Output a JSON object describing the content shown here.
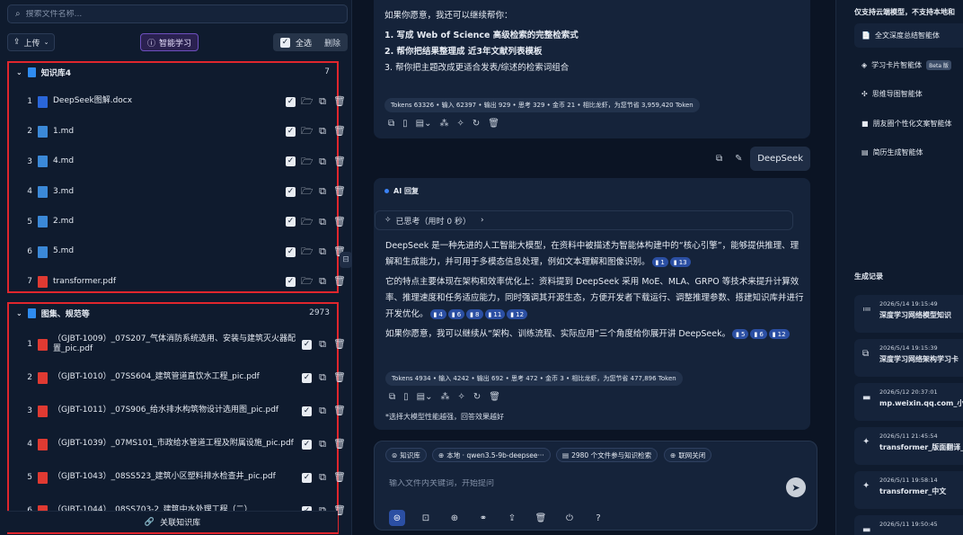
{
  "left": {
    "search_placeholder": "搜索文件名称...",
    "upload_label": "上传",
    "smart_label": "智能学习",
    "select_all_label": "全选",
    "delete_label": "删除",
    "kb1": {
      "name": "知识库4",
      "count": "7",
      "files": [
        {
          "num": "1",
          "name": "DeepSeek图解.docx",
          "type": "docx"
        },
        {
          "num": "2",
          "name": "1.md",
          "type": "md"
        },
        {
          "num": "3",
          "name": "4.md",
          "type": "md"
        },
        {
          "num": "4",
          "name": "3.md",
          "type": "md"
        },
        {
          "num": "5",
          "name": "2.md",
          "type": "md"
        },
        {
          "num": "6",
          "name": "5.md",
          "type": "md"
        },
        {
          "num": "7",
          "name": "transformer.pdf",
          "type": "pdf"
        }
      ]
    },
    "kb2": {
      "name": "图集、规范等",
      "count": "2973",
      "files": [
        {
          "num": "1",
          "name": "（GJBT-1009）_07S207_气体消防系统选用、安装与建筑灭火器配置_pic.pdf"
        },
        {
          "num": "2",
          "name": "（GJBT-1010）_07SS604_建筑管道直饮水工程_pic.pdf"
        },
        {
          "num": "3",
          "name": "（GJBT-1011）_07S906_给水排水构筑物设计选用图_pic.pdf"
        },
        {
          "num": "4",
          "name": "（GJBT-1039）_07MS101_市政给水管道工程及附属设施_pic.pdf"
        },
        {
          "num": "5",
          "name": "（GJBT-1043）_08SS523_建筑小区塑料排水检查井_pic.pdf"
        },
        {
          "num": "6",
          "name": "（GJBT-1044）_08SS703-2_建筑中水处理工程（二）"
        }
      ]
    },
    "link_kb_label": "关联知识库"
  },
  "mid": {
    "msg1": {
      "intro": "如果你愿意，我还可以继续帮你：",
      "items": [
        "1. 写成 Web of Science 高级检索的完整检索式",
        "2. 帮你把结果整理成 近3年文献列表模板",
        "3. 帮你把主题改成更适合发表/综述的检索词组合"
      ],
      "tokens": "Tokens 63326 • 输入 62397 • 输出 929 • 思考 329 • 金币 21 • 相比龙虾，为您节省 3,959,420 Token"
    },
    "user_msg": "DeepSeek",
    "msg2": {
      "header": "AI 回复",
      "think": "已思考（用时 0 秒）",
      "p1": "DeepSeek 是一种先进的人工智能大模型，在资料中被描述为智能体构建中的“核心引擎”，能够提供推理、理解和生成能力，并可用于多模态信息处理，例如文本理解和图像识别。",
      "p1_refs": [
        "1",
        "13"
      ],
      "p2": "它的特点主要体现在架构和效率优化上：资料提到 DeepSeek 采用 MoE、MLA、GRPO 等技术来提升计算效率、推理速度和任务适应能力，同时强调其开源生态，方便开发者下载运行、调整推理参数、搭建知识库并进行开发优化。",
      "p2_refs": [
        "4",
        "6",
        "8",
        "11",
        "12"
      ],
      "p3": "如果你愿意，我可以继续从“架构、训练流程、实际应用”三个角度给你展开讲 DeepSeek。",
      "p3_refs": [
        "5",
        "6",
        "12"
      ],
      "tokens": "Tokens 4934 • 输入 4242 • 输出 692 • 思考 472 • 金币 3 • 相比龙虾，为您节省 477,896 Token",
      "note": "*选择大模型性能越强，回答效果越好"
    },
    "composer": {
      "pill_kb": "知识库",
      "pill_model": "本地 · qwen3.5-9b-deepsee···",
      "pill_files": "2980 个文件参与知识检索",
      "pill_web": "联网关闭",
      "placeholder": "输入文件内关键词，开始提问"
    }
  },
  "right": {
    "top_note": "仅支持云端模型，不支持本地和",
    "agents": [
      {
        "name": "全文深度总结智能体",
        "icon": "📄"
      },
      {
        "name": "学习卡片智能体",
        "icon": "◈",
        "badge": "Beta 版"
      },
      {
        "name": "思维导图智能体",
        "icon": "✣"
      },
      {
        "name": "朋友圈个性化文案智能体",
        "icon": "■"
      },
      {
        "name": "简历生成智能体",
        "icon": "▤"
      }
    ],
    "history_title": "生成记录",
    "history": [
      {
        "time": "2026/5/14 19:15:49",
        "name": "深度学习网络模型知识"
      },
      {
        "time": "2026/5/14 19:15:39",
        "name": "深度学习网络架构学习卡"
      },
      {
        "time": "2026/5/12 20:37:01",
        "name": "mp.weixin.qq.com_小红"
      },
      {
        "time": "2026/5/11 21:45:54",
        "name": "transformer_版面翻译_"
      },
      {
        "time": "2026/5/11 19:58:14",
        "name": "transformer_中文"
      },
      {
        "time": "2026/5/11 19:50:45",
        "name": ""
      }
    ]
  }
}
